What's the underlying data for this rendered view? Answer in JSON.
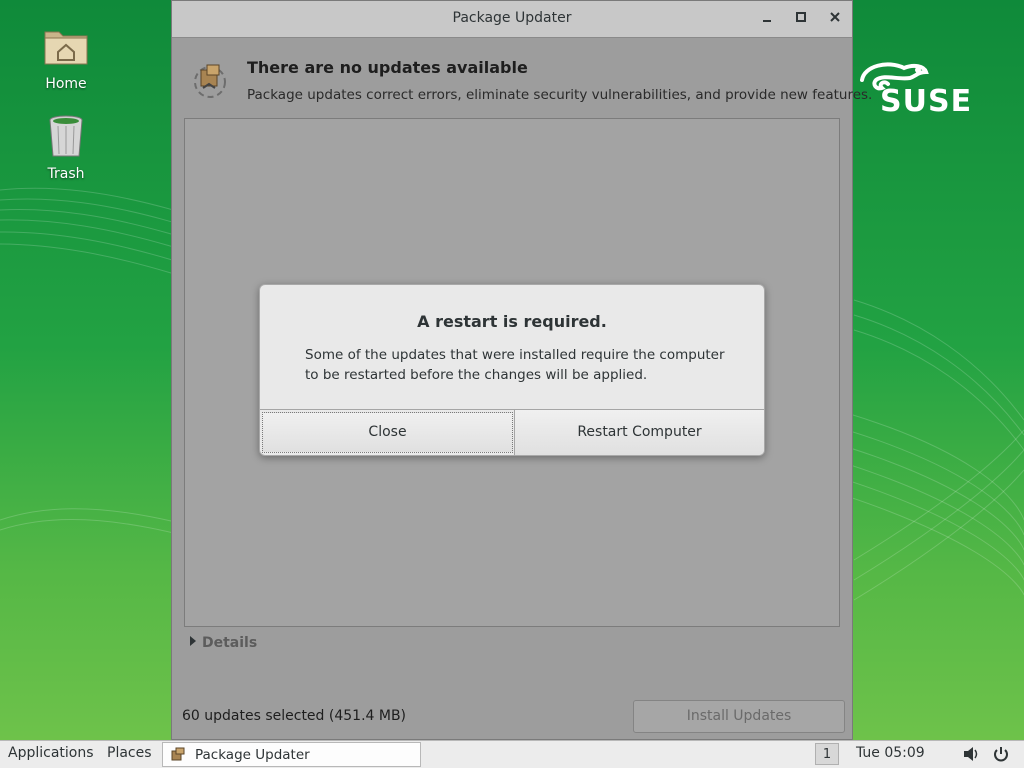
{
  "desktop": {
    "icons": [
      {
        "label": "Home"
      },
      {
        "label": "Trash"
      }
    ],
    "logo_text": "SUSE"
  },
  "window": {
    "title": "Package Updater",
    "header_title": "There are no updates available",
    "header_subtitle": "Package updates correct errors, eliminate security vulnerabilities, and provide new features.",
    "details_label": "Details",
    "status_text": "60 updates selected (451.4 MB)",
    "install_label": "Install Updates"
  },
  "dialog": {
    "title": "A restart is required.",
    "message": "Some of the updates that were installed require the computer to be restarted before the changes will be applied.",
    "close_label": "Close",
    "restart_label": "Restart Computer"
  },
  "taskbar": {
    "applications_label": "Applications",
    "places_label": "Places",
    "task_label": "Package Updater",
    "workspace": "1",
    "clock": "Tue 05:09"
  },
  "colors": {
    "desktop_green": "#22a243",
    "dialog_bg": "#e9e9e9",
    "window_dimmed": "#9d9d9d"
  }
}
